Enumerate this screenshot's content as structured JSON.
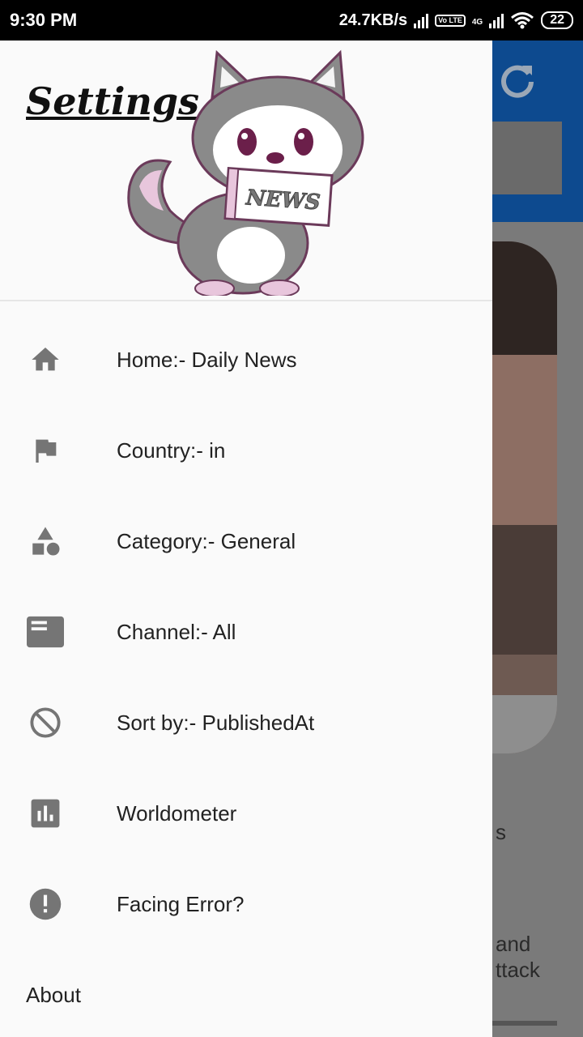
{
  "status_bar": {
    "time": "9:30 PM",
    "net_speed": "24.7KB/s",
    "volte": "Vo LTE",
    "net_type": "4G",
    "battery": "22"
  },
  "drawer": {
    "title": "Settings",
    "mascot_text": "NEWS",
    "items": [
      {
        "icon": "home-icon",
        "label": "Home:- Daily News"
      },
      {
        "icon": "flag-icon",
        "label": "Country:- in"
      },
      {
        "icon": "category-icon",
        "label": "Category:- General"
      },
      {
        "icon": "channel-icon",
        "label": "Channel:- All"
      },
      {
        "icon": "block-icon",
        "label": "Sort by:- PublishedAt"
      },
      {
        "icon": "chart-icon",
        "label": "Worldometer"
      },
      {
        "icon": "error-icon",
        "label": "Facing Error?"
      }
    ],
    "about_label": "About"
  },
  "background": {
    "snippet_1": "s",
    "snippet_2": "and",
    "snippet_3": "ttack"
  },
  "colors": {
    "toolbar": "#0d4a8f",
    "icon_gray": "#757575",
    "drawer_bg": "#fafafa"
  }
}
